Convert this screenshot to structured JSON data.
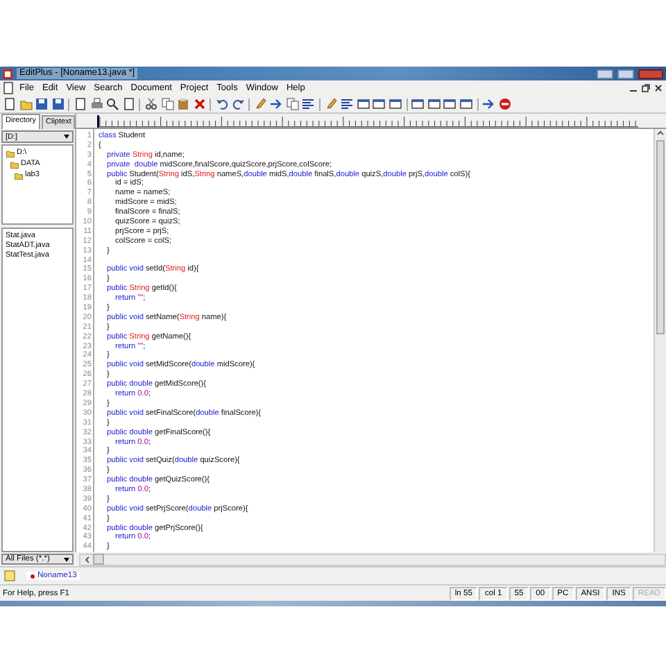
{
  "window": {
    "title": "EditPlus - [Noname13.java *]"
  },
  "menu": [
    "File",
    "Edit",
    "View",
    "Search",
    "Document",
    "Project",
    "Tools",
    "Window",
    "Help"
  ],
  "sidebar": {
    "tabs": [
      {
        "label": "Directory",
        "selected": true
      },
      {
        "label": "Cliptext",
        "selected": false
      }
    ],
    "drive": "[D:]",
    "tree": [
      {
        "label": "D:\\",
        "children": [
          {
            "label": "DATA",
            "children": [
              {
                "label": "lab3"
              }
            ]
          }
        ]
      }
    ],
    "files": [
      "Stat.java",
      "StatADT.java",
      "StatTest.java"
    ],
    "filter": "All Files (*.*)"
  },
  "editor": {
    "lines": [
      {
        "num": "1",
        "tokens": [
          {
            "kind": "kw",
            "text": "class"
          },
          {
            "kind": "p",
            "text": " Student"
          }
        ]
      },
      {
        "num": "2",
        "tokens": [
          {
            "kind": "p",
            "text": "{"
          }
        ]
      },
      {
        "num": "3",
        "tokens": [
          {
            "kind": "kw",
            "text": "\tprivate "
          },
          {
            "kind": "type",
            "text": "String"
          },
          {
            "kind": "p",
            "text": " id,name;"
          }
        ]
      },
      {
        "num": "4",
        "tokens": [
          {
            "kind": "kw",
            "text": "\tprivate  double"
          },
          {
            "kind": "p",
            "text": " midScore,finalScore,quizScore,prjScore,colScore;"
          }
        ]
      },
      {
        "num": "5",
        "tokens": [
          {
            "kind": "kw",
            "text": "\tpublic"
          },
          {
            "kind": "p",
            "text": " Student("
          },
          {
            "kind": "type",
            "text": "String"
          },
          {
            "kind": "p",
            "text": " idS,"
          },
          {
            "kind": "type",
            "text": "String"
          },
          {
            "kind": "p",
            "text": " nameS,"
          },
          {
            "kind": "kw",
            "text": "double"
          },
          {
            "kind": "p",
            "text": " midS,"
          },
          {
            "kind": "kw",
            "text": "double"
          },
          {
            "kind": "p",
            "text": " finalS,"
          },
          {
            "kind": "kw",
            "text": "double"
          },
          {
            "kind": "p",
            "text": " quizS,"
          },
          {
            "kind": "kw",
            "text": "double"
          },
          {
            "kind": "p",
            "text": " prjS,"
          },
          {
            "kind": "kw",
            "text": "double"
          },
          {
            "kind": "p",
            "text": " colS){"
          }
        ]
      },
      {
        "num": "6",
        "tokens": [
          {
            "kind": "p",
            "text": "\t\tid = idS;"
          }
        ]
      },
      {
        "num": "7",
        "tokens": [
          {
            "kind": "p",
            "text": "\t\tname = nameS;"
          }
        ]
      },
      {
        "num": "8",
        "tokens": [
          {
            "kind": "p",
            "text": "\t\tmidScore = midS;"
          }
        ]
      },
      {
        "num": "9",
        "tokens": [
          {
            "kind": "p",
            "text": "\t\tfinalScore = finalS;"
          }
        ]
      },
      {
        "num": "10",
        "tokens": [
          {
            "kind": "p",
            "text": "\t\tquizScore = quizS;"
          }
        ]
      },
      {
        "num": "11",
        "tokens": [
          {
            "kind": "p",
            "text": "\t\tprjScore = prjS;"
          }
        ]
      },
      {
        "num": "12",
        "tokens": [
          {
            "kind": "p",
            "text": "\t\tcolScore = colS;"
          }
        ]
      },
      {
        "num": "13",
        "tokens": [
          {
            "kind": "p",
            "text": "\t}"
          }
        ]
      },
      {
        "num": "14"
      },
      {
        "num": "15",
        "tokens": [
          {
            "kind": "kw",
            "text": "\tpublic void"
          },
          {
            "kind": "p",
            "text": " setId("
          },
          {
            "kind": "type",
            "text": "String"
          },
          {
            "kind": "p",
            "text": " id){"
          }
        ]
      },
      {
        "num": "16",
        "tokens": [
          {
            "kind": "p",
            "text": "\t}"
          }
        ]
      },
      {
        "num": "17",
        "tokens": [
          {
            "kind": "kw",
            "text": "\tpublic "
          },
          {
            "kind": "type",
            "text": "String"
          },
          {
            "kind": "p",
            "text": " getId(){"
          }
        ]
      },
      {
        "num": "18",
        "tokens": [
          {
            "kind": "kw",
            "text": "\t\treturn "
          },
          {
            "kind": "str",
            "text": "\"\""
          },
          {
            "kind": "p",
            "text": ";"
          }
        ]
      },
      {
        "num": "19",
        "tokens": [
          {
            "kind": "p",
            "text": "\t}"
          }
        ]
      },
      {
        "num": "20",
        "tokens": [
          {
            "kind": "kw",
            "text": "\tpublic void"
          },
          {
            "kind": "p",
            "text": " setName("
          },
          {
            "kind": "type",
            "text": "String"
          },
          {
            "kind": "p",
            "text": " name){"
          }
        ]
      },
      {
        "num": "21",
        "tokens": [
          {
            "kind": "p",
            "text": "\t}"
          }
        ]
      },
      {
        "num": "22",
        "tokens": [
          {
            "kind": "kw",
            "text": "\tpublic "
          },
          {
            "kind": "type",
            "text": "String"
          },
          {
            "kind": "p",
            "text": " getName(){"
          }
        ]
      },
      {
        "num": "23",
        "tokens": [
          {
            "kind": "kw",
            "text": "\t\treturn "
          },
          {
            "kind": "str",
            "text": "\"\""
          },
          {
            "kind": "p",
            "text": ";"
          }
        ]
      },
      {
        "num": "24",
        "tokens": [
          {
            "kind": "p",
            "text": "\t}"
          }
        ]
      },
      {
        "num": "25",
        "tokens": [
          {
            "kind": "kw",
            "text": "\tpublic void"
          },
          {
            "kind": "p",
            "text": " setMidScore("
          },
          {
            "kind": "kw",
            "text": "double"
          },
          {
            "kind": "p",
            "text": " midScore){"
          }
        ]
      },
      {
        "num": "26",
        "tokens": [
          {
            "kind": "p",
            "text": "\t}"
          }
        ]
      },
      {
        "num": "27",
        "tokens": [
          {
            "kind": "kw",
            "text": "\tpublic double"
          },
          {
            "kind": "p",
            "text": " getMidScore(){"
          }
        ]
      },
      {
        "num": "28",
        "tokens": [
          {
            "kind": "kw",
            "text": "\t\treturn "
          },
          {
            "kind": "num",
            "text": "0.0"
          },
          {
            "kind": "p",
            "text": ";"
          }
        ]
      },
      {
        "num": "29",
        "tokens": [
          {
            "kind": "p",
            "text": "\t}"
          }
        ]
      },
      {
        "num": "30",
        "tokens": [
          {
            "kind": "kw",
            "text": "\tpublic void"
          },
          {
            "kind": "p",
            "text": " setFinalScore("
          },
          {
            "kind": "kw",
            "text": "double"
          },
          {
            "kind": "p",
            "text": " finalScore){"
          }
        ]
      },
      {
        "num": "31",
        "tokens": [
          {
            "kind": "p",
            "text": "\t}"
          }
        ]
      },
      {
        "num": "32",
        "tokens": [
          {
            "kind": "kw",
            "text": "\tpublic double"
          },
          {
            "kind": "p",
            "text": " getFinalScore(){"
          }
        ]
      },
      {
        "num": "33",
        "tokens": [
          {
            "kind": "kw",
            "text": "\t\treturn "
          },
          {
            "kind": "num",
            "text": "0.0"
          },
          {
            "kind": "p",
            "text": ";"
          }
        ]
      },
      {
        "num": "34",
        "tokens": [
          {
            "kind": "p",
            "text": "\t}"
          }
        ]
      },
      {
        "num": "35",
        "tokens": [
          {
            "kind": "kw",
            "text": "\tpublic void"
          },
          {
            "kind": "p",
            "text": " setQuiz("
          },
          {
            "kind": "kw",
            "text": "double"
          },
          {
            "kind": "p",
            "text": " quizScore){"
          }
        ]
      },
      {
        "num": "36",
        "tokens": [
          {
            "kind": "p",
            "text": "\t}"
          }
        ]
      },
      {
        "num": "37",
        "tokens": [
          {
            "kind": "kw",
            "text": "\tpublic double"
          },
          {
            "kind": "p",
            "text": " getQuizScore(){"
          }
        ]
      },
      {
        "num": "38",
        "tokens": [
          {
            "kind": "kw",
            "text": "\t\treturn "
          },
          {
            "kind": "num",
            "text": "0.0"
          },
          {
            "kind": "p",
            "text": ";"
          }
        ]
      },
      {
        "num": "39",
        "tokens": [
          {
            "kind": "p",
            "text": "\t}"
          }
        ]
      },
      {
        "num": "40",
        "tokens": [
          {
            "kind": "kw",
            "text": "\tpublic void"
          },
          {
            "kind": "p",
            "text": " setPrjScore("
          },
          {
            "kind": "kw",
            "text": "double"
          },
          {
            "kind": "p",
            "text": " prjScore){"
          }
        ]
      },
      {
        "num": "41",
        "tokens": [
          {
            "kind": "p",
            "text": "\t}"
          }
        ]
      },
      {
        "num": "42",
        "tokens": [
          {
            "kind": "kw",
            "text": "\tpublic double"
          },
          {
            "kind": "p",
            "text": " getPrjScore(){"
          }
        ]
      },
      {
        "num": "43",
        "tokens": [
          {
            "kind": "kw",
            "text": "\t\treturn "
          },
          {
            "kind": "num",
            "text": "0.0"
          },
          {
            "kind": "p",
            "text": ";"
          }
        ]
      },
      {
        "num": "44",
        "tokens": [
          {
            "kind": "p",
            "text": "\t}"
          }
        ]
      }
    ]
  },
  "document_tabs": [
    {
      "label": "Noname13",
      "selected": true,
      "modified": true
    }
  ],
  "status_bar": {
    "message": "For Help, press F1",
    "panels": [
      {
        "text": "ln 55",
        "disabled": false
      },
      {
        "text": "col 1",
        "disabled": false
      },
      {
        "text": "55",
        "disabled": false
      },
      {
        "text": "00",
        "disabled": false
      },
      {
        "text": "PC",
        "disabled": false
      },
      {
        "text": "ANSI",
        "disabled": false
      },
      {
        "text": "INS",
        "disabled": false
      },
      {
        "text": "READ",
        "disabled": true
      }
    ]
  }
}
